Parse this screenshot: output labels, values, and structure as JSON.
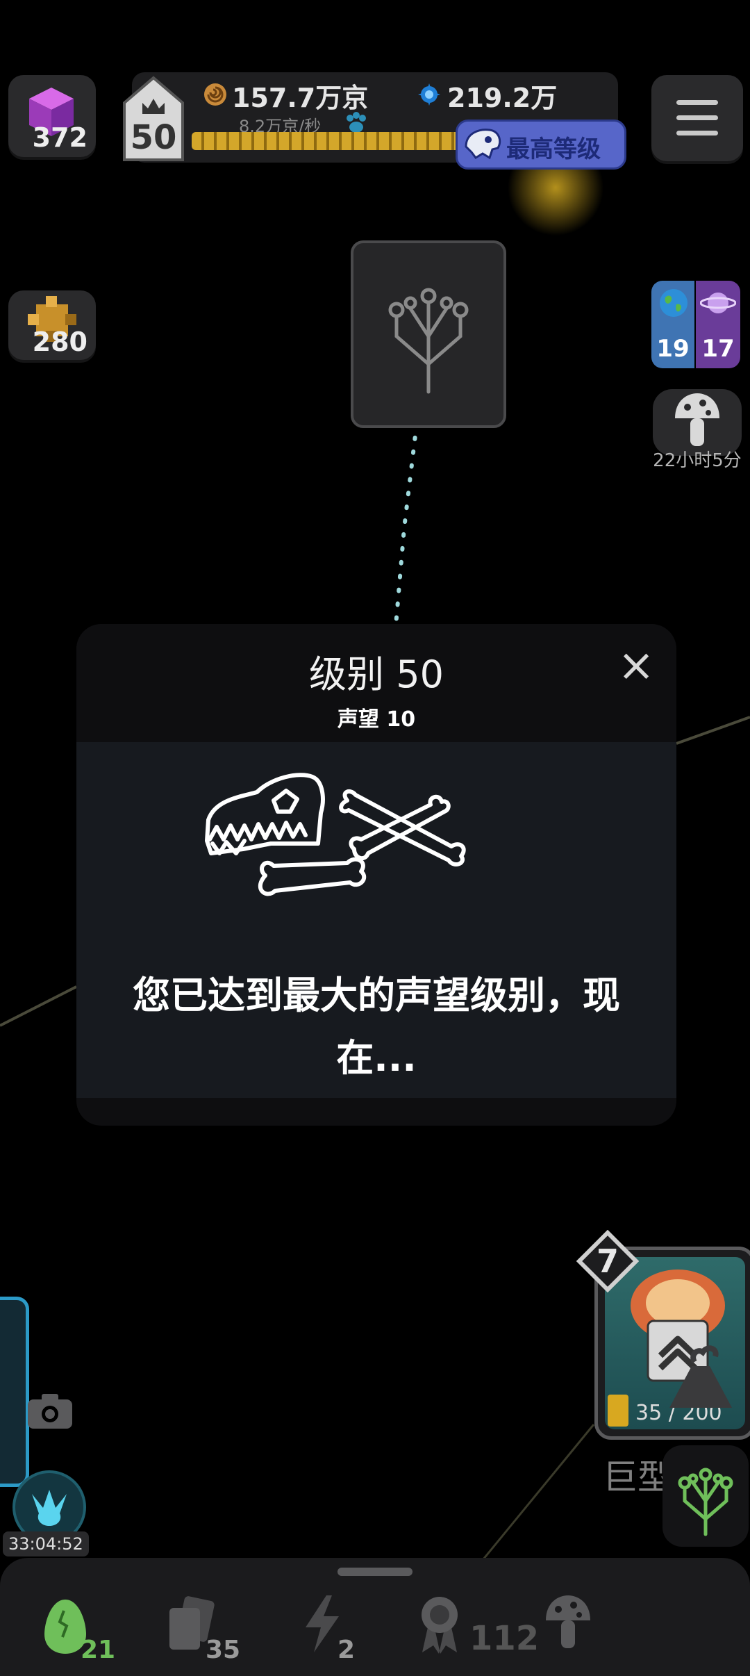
{
  "top": {
    "cubes_count": "372",
    "level": "50",
    "currency1": "157.7万京",
    "currency1_rate": "8.2万京/秒",
    "currency2": "219.2万",
    "level_progress": 1.0,
    "max_level_label": "最高等级"
  },
  "side": {
    "puzzle_count": "280",
    "earth_count": "19",
    "planet_count": "17",
    "mushroom_timer": "22小时5分"
  },
  "modal": {
    "title": "级别 50",
    "subtitle": "声望 10",
    "message": "您已达到最大的声望级别，现在..."
  },
  "card": {
    "level": "7",
    "progress": "35 / 200",
    "name": "巨型水母"
  },
  "left": {
    "timer": "33:04:52"
  },
  "nav": {
    "eggs": "21",
    "cards": "35",
    "energy": "2",
    "awards": "112"
  },
  "colors": {
    "accent_gold": "#d4a72a",
    "max_pill": "#5766c9",
    "egg_green": "#6fbf5a",
    "tree_line": "#9fd9dc"
  }
}
